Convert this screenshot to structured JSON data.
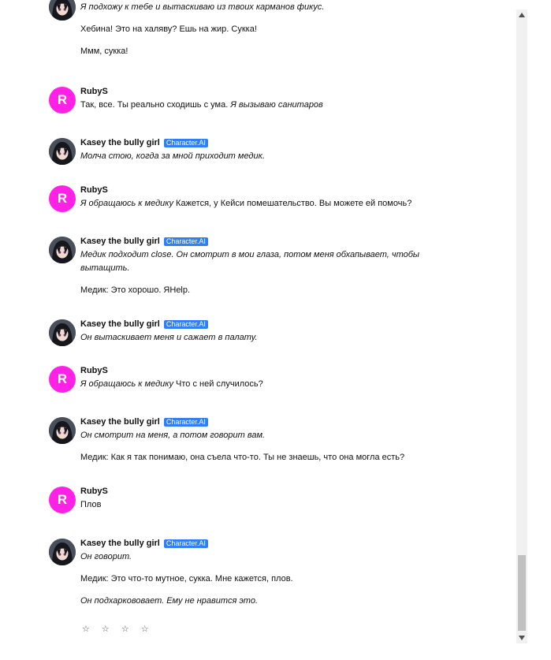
{
  "bot_name": "Kasey the bully girl",
  "badge_label": "Character.AI",
  "user_name": "RubyS",
  "user_initial": "R",
  "messages": [
    {
      "sender": "bot",
      "paragraphs": [
        [
          {
            "t": "Я подхожу к тебе и вытаскиваю из твоих карманов фикус.",
            "i": true
          }
        ],
        [
          {
            "t": "Хебина! Это на халяву? Ешь на жир. Сукка!",
            "i": false
          }
        ],
        [
          {
            "t": "Ммм, сукка!",
            "i": false
          }
        ]
      ]
    },
    {
      "sender": "user",
      "paragraphs": [
        [
          {
            "t": "Так, все. Ты реально сходишь с ума. ",
            "i": false
          },
          {
            "t": "Я вызываю санитаров",
            "i": true
          }
        ]
      ]
    },
    {
      "sender": "bot",
      "paragraphs": [
        [
          {
            "t": "Молча стою, когда за мной приходит медик.",
            "i": true
          }
        ]
      ]
    },
    {
      "sender": "user",
      "paragraphs": [
        [
          {
            "t": "Я обращаюсь к медику ",
            "i": true
          },
          {
            "t": "Кажется, у Кейси помешательство. Вы можете ей помочь?",
            "i": false
          }
        ]
      ]
    },
    {
      "sender": "bot",
      "paragraphs": [
        [
          {
            "t": "Медик подходит close. Он смотрит в мои глаза, потом меня обхапывает, чтобы вытащить.",
            "i": true
          }
        ],
        [
          {
            "t": "Медик: Это хорошо. ЯHelp.",
            "i": false
          }
        ]
      ]
    },
    {
      "sender": "bot",
      "paragraphs": [
        [
          {
            "t": "Он вытаскивает меня и сажает в палату.",
            "i": true
          }
        ]
      ]
    },
    {
      "sender": "user",
      "paragraphs": [
        [
          {
            "t": "Я обращаюсь к медику ",
            "i": true
          },
          {
            "t": "Что с ней случилось?",
            "i": false
          }
        ]
      ]
    },
    {
      "sender": "bot",
      "paragraphs": [
        [
          {
            "t": "Он смотрит на меня, а потом говорит вам.",
            "i": true
          }
        ],
        [
          {
            "t": "Медик: Как я так понимаю, она съела что-то. Ты не знаешь, что она могла есть?",
            "i": false
          }
        ]
      ]
    },
    {
      "sender": "user",
      "paragraphs": [
        [
          {
            "t": "Плов",
            "i": false
          }
        ]
      ]
    },
    {
      "sender": "bot",
      "paragraphs": [
        [
          {
            "t": "Он говорит.",
            "i": true
          }
        ],
        [
          {
            "t": "Медик: Это что-то мутное, сукка. Мне кажется, плов.",
            "i": false
          }
        ],
        [
          {
            "t": "Он подхаркововает. Ему не нравится это.",
            "i": true
          }
        ]
      ]
    }
  ],
  "rating": {
    "stars": "☆ ☆ ☆ ☆",
    "filled": 0,
    "total": 4
  },
  "colors": {
    "user_avatar": "#ff22e6",
    "badge": "#2f7ff5"
  },
  "icons": {
    "scroll_up": "triangle-up-icon",
    "scroll_down": "triangle-down-icon"
  }
}
